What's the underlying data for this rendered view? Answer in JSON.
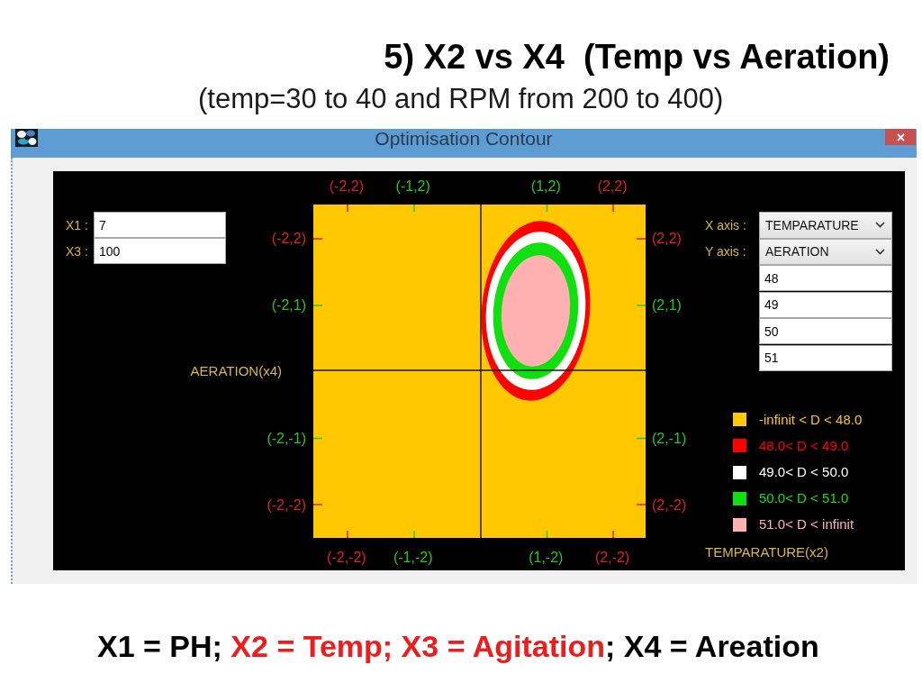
{
  "slide": {
    "title": "5) X2 vs X4  (Temp vs Aeration)",
    "subtitle": "(temp=30 to 40 and RPM from 200 to 400)",
    "footnote": [
      {
        "text": "X1 = PH; ",
        "color": "#000000"
      },
      {
        "text": "X2 = Temp; X3 = Agitation",
        "color": "#ee1c1c"
      },
      {
        "text": "; X4 = Areation",
        "color": "#000000"
      }
    ]
  },
  "window": {
    "title": "Optimisation Contour"
  },
  "fixed_inputs": [
    {
      "label": "X1 :",
      "value": "7"
    },
    {
      "label": "X3 :",
      "value": "100"
    }
  ],
  "axis_selectors": [
    {
      "label": "X axis :",
      "value": "TEMPARATURE"
    },
    {
      "label": "Y axis :",
      "value": "AERATION"
    }
  ],
  "level_inputs": [
    "48",
    "49",
    "50",
    "51"
  ],
  "plot": {
    "y_axis_label": "AERATION(x4)",
    "x_axis_label": "TEMPARATURE(x2)",
    "top_labels": [
      {
        "text": "(-2,2)",
        "color": "#e02020"
      },
      {
        "text": "(-1,2)",
        "color": "#22c822"
      },
      {
        "text": "(1,2)",
        "color": "#22c822"
      },
      {
        "text": "(2,2)",
        "color": "#e02020"
      }
    ],
    "left_labels": [
      {
        "text": "(-2,2)",
        "color": "#e02020"
      },
      {
        "text": "(-2,1)",
        "color": "#22c822"
      },
      {
        "text": "(-2,-1)",
        "color": "#22c822"
      },
      {
        "text": "(-2,-2)",
        "color": "#e02020"
      }
    ],
    "right_labels": [
      {
        "text": "(2,2)",
        "color": "#e02020"
      },
      {
        "text": "(2,1)",
        "color": "#22c822"
      },
      {
        "text": "(2,-1)",
        "color": "#22c822"
      },
      {
        "text": "(2,-2)",
        "color": "#e02020"
      }
    ],
    "bottom_labels": [
      {
        "text": "(-2,-2)",
        "color": "#e02020"
      },
      {
        "text": "(-1,-2)",
        "color": "#22c822"
      },
      {
        "text": "(1,-2)",
        "color": "#22c822"
      },
      {
        "text": "(2,-2)",
        "color": "#e02020"
      }
    ]
  },
  "legend": [
    {
      "text": "-infinit < D < 48.0",
      "color": "#ffc800"
    },
    {
      "text": "48.0< D < 49.0",
      "color": "#ff0000"
    },
    {
      "text": "49.0< D < 50.0",
      "color": "#ffffff"
    },
    {
      "text": "50.0< D < 51.0",
      "color": "#10e010"
    },
    {
      "text": "51.0< D < infinit",
      "color": "#ffb0b0"
    }
  ]
}
